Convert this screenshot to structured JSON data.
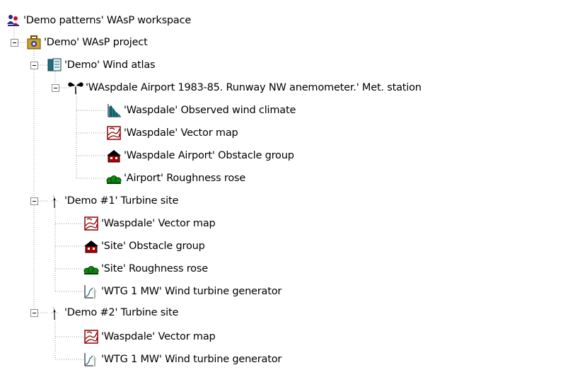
{
  "tree": {
    "workspace": {
      "label": "'Demo patterns' WAsP workspace",
      "icon": "people-workspace-icon"
    },
    "project": {
      "label": "'Demo' WAsP project",
      "icon": "briefcase-project-icon"
    },
    "wind_atlas": {
      "label": "'Demo' Wind atlas",
      "icon": "book-atlas-icon"
    },
    "met_station": {
      "label": "'WAspdale Airport 1983-85. Runway NW anemometer.' Met. station",
      "icon": "anemometer-icon"
    },
    "observed_climate": {
      "label": "'Waspdale' Observed wind climate",
      "icon": "histogram-climate-icon"
    },
    "atlas_vector_map": {
      "label": "'Waspdale' Vector map",
      "icon": "vector-map-icon"
    },
    "atlas_obstacle_group": {
      "label": "'Waspdale Airport' Obstacle group",
      "icon": "house-obstacle-icon"
    },
    "atlas_roughness_rose": {
      "label": "'Airport' Roughness rose",
      "icon": "trees-roughness-icon"
    },
    "turbine_site_1": {
      "label": "'Demo #1' Turbine site",
      "icon": "turbine-site-icon"
    },
    "site1_vector_map": {
      "label": "'Waspdale' Vector map",
      "icon": "vector-map-icon"
    },
    "site1_obstacle_group": {
      "label": "'Site' Obstacle group",
      "icon": "house-obstacle-icon"
    },
    "site1_roughness_rose": {
      "label": "'Site' Roughness rose",
      "icon": "trees-roughness-icon"
    },
    "site1_wtg": {
      "label": "'WTG 1 MW' Wind turbine generator",
      "icon": "power-curve-turbine-icon"
    },
    "turbine_site_2": {
      "label": "'Demo #2' Turbine site",
      "icon": "turbine-site-icon"
    },
    "site2_vector_map": {
      "label": "'Waspdale' Vector map",
      "icon": "vector-map-icon"
    },
    "site2_wtg": {
      "label": "'WTG 1 MW' Wind turbine generator",
      "icon": "power-curve-turbine-icon"
    }
  }
}
